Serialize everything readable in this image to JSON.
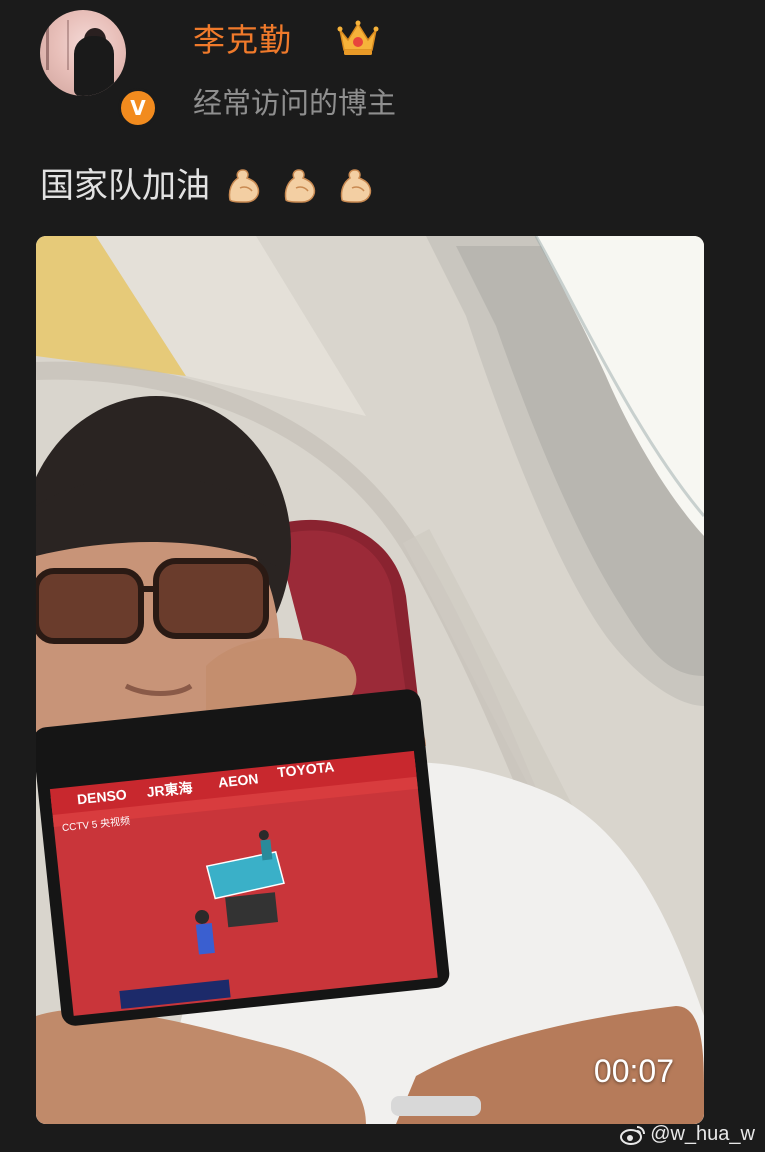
{
  "author": {
    "name": "李克勤",
    "subtitle": "经常访问的博主",
    "verified_mark": "V",
    "badge_icon": "crown-icon",
    "accent_color": "#f07a2b"
  },
  "post": {
    "text": "国家队加油",
    "emoji_icons": [
      "flexed-biceps-icon",
      "flexed-biceps-icon",
      "flexed-biceps-icon"
    ]
  },
  "video": {
    "duration": "00:07",
    "phone_overlay": {
      "sponsors": [
        "DENSO",
        "JR東海",
        "AEON",
        "TOYOTA"
      ],
      "channel": "CCTV 5 央视频"
    }
  },
  "watermark": {
    "text": "@w_hua_w",
    "icon": "weibo-icon"
  }
}
